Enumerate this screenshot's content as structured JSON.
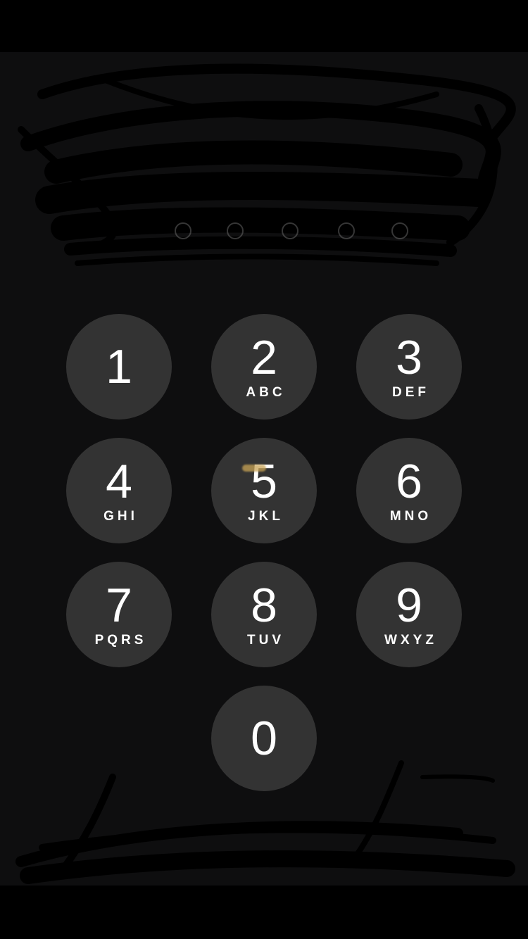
{
  "keypad": {
    "keys": [
      {
        "digit": "1",
        "letters": ""
      },
      {
        "digit": "2",
        "letters": "ABC"
      },
      {
        "digit": "3",
        "letters": "DEF"
      },
      {
        "digit": "4",
        "letters": "GHI"
      },
      {
        "digit": "5",
        "letters": "JKL"
      },
      {
        "digit": "6",
        "letters": "MNO"
      },
      {
        "digit": "7",
        "letters": "PQRS"
      },
      {
        "digit": "8",
        "letters": "TUV"
      },
      {
        "digit": "9",
        "letters": "WXYZ"
      },
      {
        "digit": "0",
        "letters": ""
      }
    ]
  },
  "colors": {
    "key_background": "#333333",
    "screen_background": "#0e0e0f",
    "text": "#ffffff"
  }
}
